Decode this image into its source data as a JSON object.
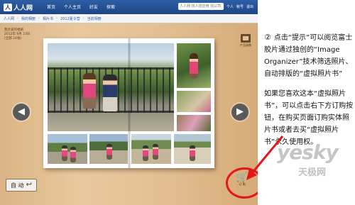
{
  "app": {
    "logo_text": "人人网",
    "nav": [
      "首页",
      "个人主页",
      "好友",
      "探索"
    ],
    "search_placeholder": "人人网 找人找应用 找公司",
    "user_links": [
      "个人",
      "帐号",
      "退出"
    ],
    "breadcrumb": [
      "人人网",
      "我的相册",
      "相片书",
      "2012夏令营",
      "当前相册"
    ],
    "album_info": [
      "我亲爱的相册",
      "2012年 9月 23日",
      "(全部 24张)"
    ],
    "product_icon_label": "产品选购",
    "auto_button_label": "自 动",
    "cart_label": "订 购",
    "prev_arrow": "◀",
    "next_arrow": "▶"
  },
  "explanation": {
    "step_number": "②",
    "paragraph1": "点击“提示”可以阅览富士胶片通过独创的“Image Organizer”技术筛选照片、自动排版的“虚拟照片书”",
    "paragraph2": "如果您喜欢这本“虚拟照片书”，可以点击右下方订购按钮，在购买页面订购实体照片书或者去买“虚拟照片书”永久使用权。"
  },
  "watermark": {
    "brand": "yesky",
    "sub": "天极网"
  },
  "colors": {
    "topbar": "#1d4686",
    "annotation_red": "#e2161b",
    "wood": "#e3c094"
  }
}
